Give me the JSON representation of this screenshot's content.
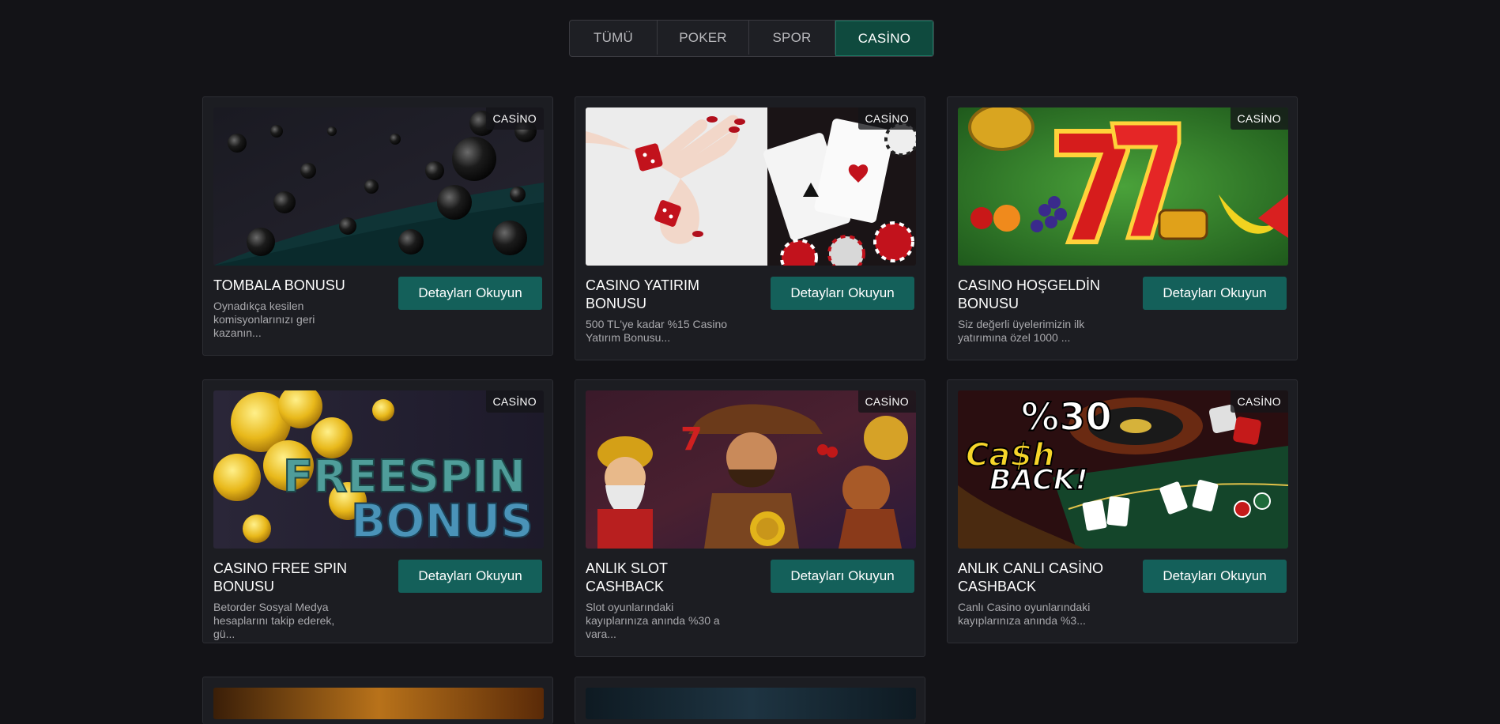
{
  "tabs": [
    {
      "label": "TÜMÜ",
      "active": false
    },
    {
      "label": "POKER",
      "active": false
    },
    {
      "label": "SPOR",
      "active": false
    },
    {
      "label": "CASİNO",
      "active": true
    }
  ],
  "button_label": "Detayları Okuyun",
  "cards": [
    {
      "badge": "CASİNO",
      "title": "TOMBALA BONUSU",
      "desc": "Oynadıkça kesilen komisyonlarınızı geri kazanın..."
    },
    {
      "badge": "CASİNO",
      "title": "CASINO YATIRIM BONUSU",
      "desc": "500 TL'ye kadar %15 Casino Yatırım Bonusu..."
    },
    {
      "badge": "CASİNO",
      "title": "CASINO HOŞGELDİN BONUSU",
      "desc": "Siz değerli üyelerimizin ilk yatırımına özel 1000 ..."
    },
    {
      "badge": "CASİNO",
      "title": "CASINO FREE SPIN BONUSU",
      "desc": "Betorder Sosyal Medya hesaplarını takip ederek, gü..."
    },
    {
      "badge": "CASİNO",
      "title": "ANLIK SLOT CASHBACK",
      "desc": "Slot oyunlarındaki kayıplarınıza anında %30 a vara..."
    },
    {
      "badge": "CASİNO",
      "title": "ANLIK CANLI CASİNO CASHBACK",
      "desc": "Canlı Casino oyunlarındaki kayıplarınıza anında %3..."
    }
  ],
  "images": {
    "freespin_line1": "FREESPIN",
    "freespin_line2": "BONUS",
    "cashback_pct": "%30",
    "cashback_line1": "Ca$h",
    "cashback_line2": "BACK!"
  }
}
